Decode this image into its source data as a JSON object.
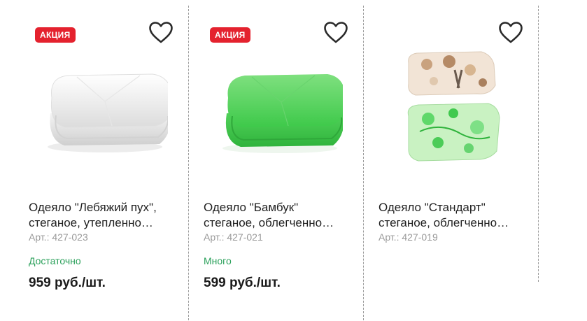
{
  "products": [
    {
      "badge": "АКЦИЯ",
      "title_line1": "Одеяло \"Лебяжий пух\",",
      "title_line2": "стеганое, утепленно…",
      "sku": "Арт.: 427-023",
      "stock": "Достаточно",
      "price": "959 руб./шт.",
      "image_icon": "white-quilted-blanket-image"
    },
    {
      "badge": "АКЦИЯ",
      "title_line1": "Одеяло \"Бамбук\"",
      "title_line2": "стеганое, облегченно…",
      "sku": "Арт.: 427-021",
      "stock": "Много",
      "price": "599 руб./шт.",
      "image_icon": "green-quilted-blanket-image"
    },
    {
      "title_line1": "Одеяло \"Стандарт\"",
      "title_line2": "стеганое, облегченно…",
      "sku": "Арт.: 427-019",
      "image_icon": "printed-blankets-image"
    }
  ],
  "colors": {
    "badge": "#e4222e",
    "stock": "#2aa05a",
    "sku": "#9a9a9a",
    "text": "#1f1f1f"
  }
}
